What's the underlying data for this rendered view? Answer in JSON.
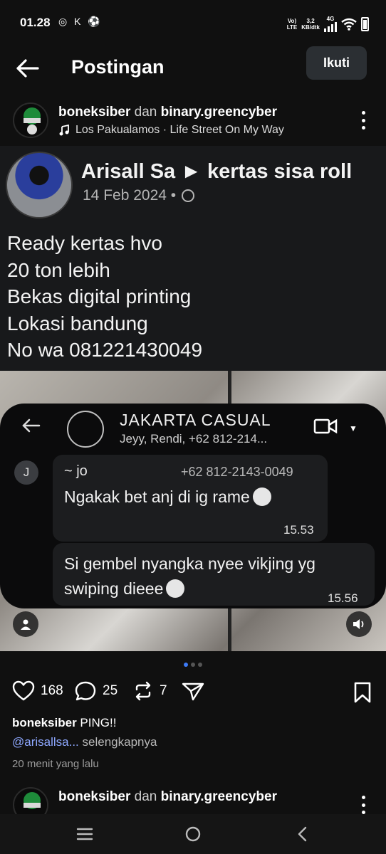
{
  "status_bar": {
    "time": "01.28",
    "left_icons": "◎ K ⚽",
    "net_top": "Vo)",
    "net_bottom": "LTE",
    "speed_top": "3,2",
    "speed_bottom": "KB/dtk",
    "gen": "4G",
    "icons": [
      "instagram-icon",
      "k-icon",
      "ball-icon",
      "signal-icon",
      "wifi-icon",
      "battery-icon"
    ]
  },
  "header": {
    "title": "Postingan",
    "follow_label": "Ikuti"
  },
  "post": {
    "author1": "boneksiber",
    "and_text": " dan ",
    "author2": "binary.greencyber",
    "music": "Los Pakualamos · Life Street On My Way"
  },
  "media": {
    "fb_name": "Arisall Sa ► kertas sisa roll",
    "fb_date": "14 Feb 2024 •",
    "fb_text": [
      "Ready  kertas hvo",
      "20 ton lebih",
      "Bekas digital printing",
      "Lokasi bandung",
      "No wa 081221430049"
    ],
    "chat_group": "JAKARTA CASUAL",
    "chat_members": "Jeyy, Rendi, +62 812-214...",
    "chat_initial": "J",
    "sender": "~ jo",
    "sender_phone": "+62 812-2143-0049",
    "message1": "Ngakak bet anj di ig rame",
    "time1": "15.53",
    "message2_line1": "Si gembel nyangka nyee vikjing yg",
    "message2_line2": "swiping dieee",
    "time2": "15.56"
  },
  "carousel": {
    "count": 3,
    "active_index": 0,
    "active_color": "#3d7bf7"
  },
  "actions": {
    "likes": "168",
    "comments": "25",
    "reposts": "7"
  },
  "caption": {
    "user": "boneksiber",
    "text": " PING!!",
    "mention": "@arisallsa...",
    "more": " selengkapnya",
    "time_ago": "20 menit yang lalu"
  },
  "next_post": {
    "author1": "boneksiber",
    "and_text": " dan ",
    "author2": "binary.greencyber"
  },
  "colors": {
    "background": "#101010",
    "button_bg": "#2b2f33",
    "mention": "#8ea8ff"
  }
}
